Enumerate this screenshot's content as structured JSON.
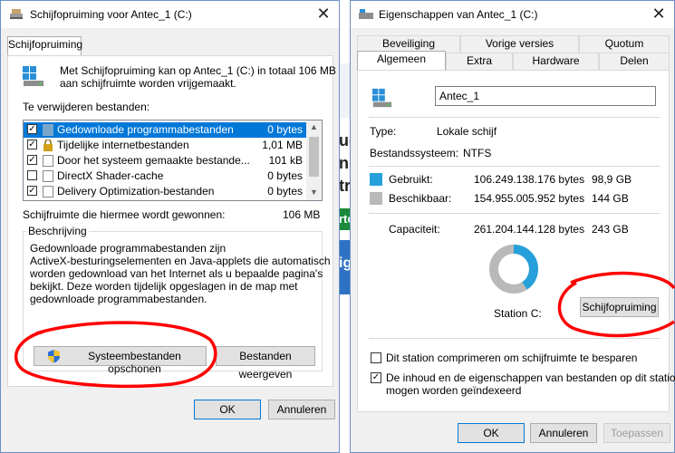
{
  "left_window": {
    "title": "Schijfopruiming voor Antec_1 (C:)",
    "tab": "Schijfopruiming",
    "intro": "Met Schijfopruiming kan op Antec_1 (C:) in totaal 106 MB aan schijfruimte worden vrijgemaakt.",
    "intro_line1": "Met Schijfopruiming kan op Antec_1 (C:) in totaal 106 MB",
    "intro_line2": "aan schijfruimte worden vrijgemaakt.",
    "files_label": "Te verwijderen bestanden:",
    "items": [
      {
        "label": "Gedownloade programmabestanden",
        "size": "0 bytes",
        "checked": true,
        "selected": true
      },
      {
        "label": "Tijdelijke internetbestanden",
        "size": "1,01 MB",
        "checked": true,
        "selected": false
      },
      {
        "label": "Door het systeem gemaakte bestande...",
        "size": "101 kB",
        "checked": true,
        "selected": false
      },
      {
        "label": "DirectX Shader-cache",
        "size": "0 bytes",
        "checked": false,
        "selected": false
      },
      {
        "label": "Delivery Optimization-bestanden",
        "size": "0 bytes",
        "checked": true,
        "selected": false
      }
    ],
    "gain_label": "Schijfruimte die hiermee wordt gewonnen:",
    "gain_value": "106 MB",
    "description_label": "Beschrijving",
    "description_lines": [
      "Gedownloade programmabestanden zijn",
      "ActiveX-besturingselementen en Java-applets die automatisch",
      "worden gedownload van het Internet als u bepaalde pagina's",
      "bekijkt. Deze worden tijdelijk opgeslagen in de map met",
      "gedownloade programmabestanden."
    ],
    "system_files_button": "Systeembestanden opschonen",
    "view_files_button": "Bestanden weergeven",
    "ok_button": "OK",
    "cancel_button": "Annuleren"
  },
  "right_window": {
    "title": "Eigenschappen van Antec_1 (C:)",
    "tabs_row1": [
      "Beveiliging",
      "Vorige versies",
      "Quotum"
    ],
    "tabs_row2": [
      "Algemeen",
      "Extra",
      "Hardware",
      "Delen"
    ],
    "drive_name": "Antec_1",
    "type_label": "Type:",
    "type_value": "Lokale schijf",
    "fs_label": "Bestandssysteem:",
    "fs_value": "NTFS",
    "used_label": "Gebruikt:",
    "used_bytes": "106.249.138.176 bytes",
    "used_gb": "98,9 GB",
    "free_label": "Beschikbaar:",
    "free_bytes": "154.955.005.952 bytes",
    "free_gb": "144 GB",
    "capacity_label": "Capaciteit:",
    "capacity_bytes": "261.204.144.128 bytes",
    "capacity_gb": "243 GB",
    "used_fraction": 0.407,
    "station_label": "Station C:",
    "cleanup_button": "Schijfopruiming",
    "compress_label": "Dit station comprimeren om schijfruimte te besparen",
    "compress_checked": false,
    "index_line1": "De inhoud en de eigenschappen van bestanden op dit station",
    "index_line2": "mogen worden geïndexeerd",
    "index_checked": true,
    "ok_button": "OK",
    "cancel_button": "Annuleren",
    "apply_button": "Toepassen"
  },
  "background_fragments": [
    "uc",
    "ni",
    "tro",
    "rte",
    "igu"
  ],
  "colors": {
    "used": "#26a0da",
    "free": "#b9b9b9",
    "selection": "#0078d7",
    "annotation": "#ff0000"
  }
}
